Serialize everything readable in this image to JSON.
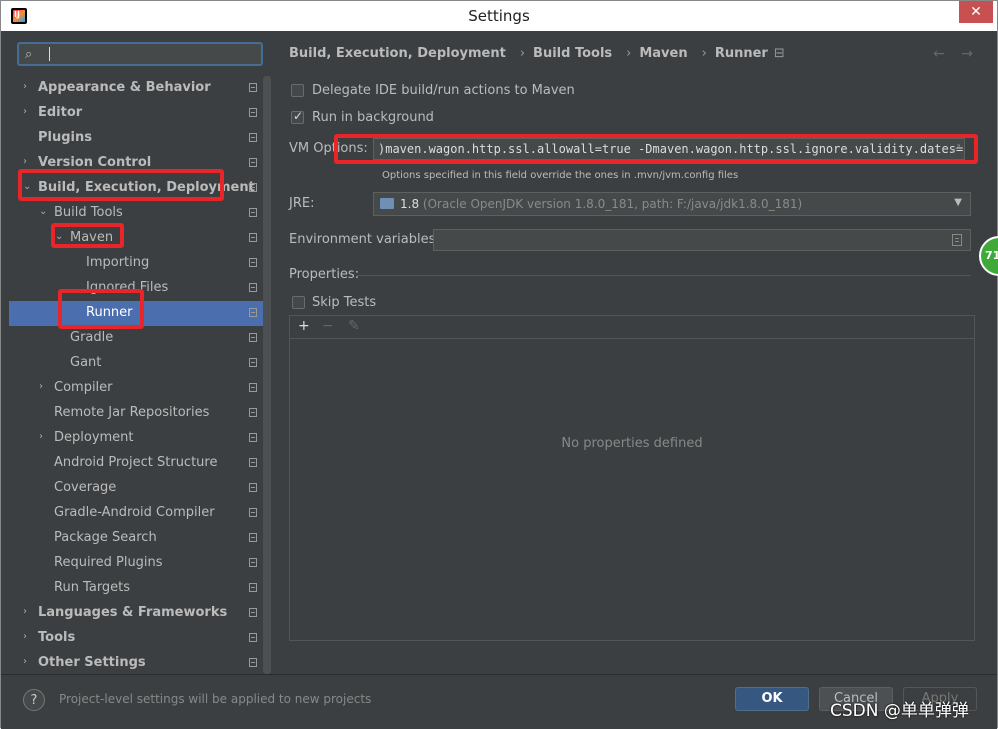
{
  "window": {
    "title": "Settings",
    "close_symbol": "✕"
  },
  "search": {
    "placeholder": ""
  },
  "sidebar": {
    "items": [
      {
        "label": "Appearance & Behavior",
        "level": 0,
        "arrow": "›",
        "bold": true
      },
      {
        "label": "Editor",
        "level": 0,
        "arrow": "›",
        "bold": true
      },
      {
        "label": "Plugins",
        "level": 0,
        "arrow": "",
        "bold": true
      },
      {
        "label": "Version Control",
        "level": 0,
        "arrow": "›",
        "bold": true
      },
      {
        "label": "Build, Execution, Deployment",
        "level": 0,
        "arrow": "⌄",
        "bold": true
      },
      {
        "label": "Build Tools",
        "level": 1,
        "arrow": "⌄",
        "bold": false
      },
      {
        "label": "Maven",
        "level": 2,
        "arrow": "⌄",
        "bold": false
      },
      {
        "label": "Importing",
        "level": 3,
        "arrow": "",
        "bold": false
      },
      {
        "label": "Ignored Files",
        "level": 3,
        "arrow": "",
        "bold": false
      },
      {
        "label": "Runner",
        "level": 3,
        "arrow": "",
        "bold": false,
        "selected": true
      },
      {
        "label": "Gradle",
        "level": 2,
        "arrow": "",
        "bold": false
      },
      {
        "label": "Gant",
        "level": 2,
        "arrow": "",
        "bold": false
      },
      {
        "label": "Compiler",
        "level": 1,
        "arrow": "›",
        "bold": false
      },
      {
        "label": "Remote Jar Repositories",
        "level": 1,
        "arrow": "",
        "bold": false
      },
      {
        "label": "Deployment",
        "level": 1,
        "arrow": "›",
        "bold": false
      },
      {
        "label": "Android Project Structure",
        "level": 1,
        "arrow": "",
        "bold": false
      },
      {
        "label": "Coverage",
        "level": 1,
        "arrow": "",
        "bold": false
      },
      {
        "label": "Gradle-Android Compiler",
        "level": 1,
        "arrow": "",
        "bold": false
      },
      {
        "label": "Package Search",
        "level": 1,
        "arrow": "",
        "bold": false
      },
      {
        "label": "Required Plugins",
        "level": 1,
        "arrow": "",
        "bold": false
      },
      {
        "label": "Run Targets",
        "level": 1,
        "arrow": "",
        "bold": false
      },
      {
        "label": "Languages & Frameworks",
        "level": 0,
        "arrow": "›",
        "bold": true
      },
      {
        "label": "Tools",
        "level": 0,
        "arrow": "›",
        "bold": true
      },
      {
        "label": "Other Settings",
        "level": 0,
        "arrow": "›",
        "bold": true
      }
    ]
  },
  "breadcrumb": [
    "Build, Execution, Deployment",
    "Build Tools",
    "Maven",
    "Runner"
  ],
  "nav": {
    "back": "←",
    "forward": "→"
  },
  "options": {
    "delegate_label": "Delegate IDE build/run actions to Maven",
    "delegate_checked": false,
    "background_label": "Run in background",
    "background_checked": true,
    "vm_label": "VM Options:",
    "vm_value": ")maven.wagon.http.ssl.allowall=true -Dmaven.wagon.http.ssl.ignore.validity.dates=",
    "vm_hint": "Options specified in this field override the ones in .mvn/jvm.config files",
    "jre_label": "JRE:",
    "jre_version": "1.8",
    "jre_desc": " (Oracle OpenJDK version 1.8.0_181, path: F:/java/jdk1.8.0_181)",
    "env_label": "Environment variables:",
    "env_value": "",
    "properties_label": "Properties:",
    "skip_tests_label": "Skip Tests",
    "skip_tests_checked": false,
    "toolbar": {
      "add": "+",
      "remove": "−",
      "edit": "✎"
    },
    "empty_text": "No properties defined"
  },
  "footer": {
    "help": "?",
    "text": "Project-level settings will be applied to new projects",
    "ok": "OK",
    "cancel": "Cancel",
    "apply": "Apply"
  },
  "overlay": {
    "bubble": "71",
    "watermark": "CSDN @单单弹弹"
  },
  "colors": {
    "accent": "#4b6eaf",
    "highlight_box": "#e8262a",
    "ok_button": "#365880",
    "background": "#3c3f41"
  }
}
